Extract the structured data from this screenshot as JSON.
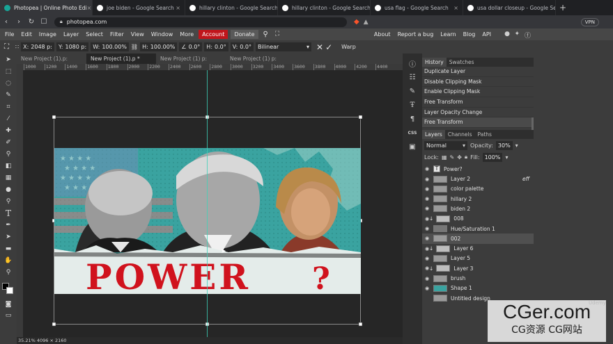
{
  "browser": {
    "tabs": [
      {
        "title": "Photopea | Online Photo Edi",
        "active": true,
        "favicon_color": "#18a497"
      },
      {
        "title": "joe biden - Google Search",
        "active": false,
        "favicon_color": "#ffffff"
      },
      {
        "title": "hillary clinton - Google Search",
        "active": false,
        "favicon_color": "#ffffff"
      },
      {
        "title": "hillary clinton - Google Search",
        "active": false,
        "favicon_color": "#ffffff"
      },
      {
        "title": "usa flag - Google Search",
        "active": false,
        "favicon_color": "#ffffff"
      },
      {
        "title": "usa dollar closeup - Google Sea",
        "active": false,
        "favicon_color": "#ffffff"
      }
    ],
    "url": "photopea.com",
    "vpn_label": "VPN"
  },
  "menu": {
    "items": [
      "File",
      "Edit",
      "Image",
      "Layer",
      "Select",
      "Filter",
      "View",
      "Window",
      "More"
    ],
    "account": "Account",
    "donate": "Donate",
    "right": [
      "About",
      "Report a bug",
      "Learn",
      "Blog",
      "API"
    ]
  },
  "options": {
    "x_label": "X:",
    "x_value": "2048 p:",
    "y_label": "Y:",
    "y_value": "1080 p:",
    "w_label": "W:",
    "w_value": "100.00%",
    "h_label": "H:",
    "h_value": "100.00%",
    "angle_value": "0.0°",
    "hskew_label": "H:",
    "hskew_value": "0.0°",
    "vskew_label": "V:",
    "vskew_value": "0.0°",
    "interp": "Bilinear",
    "warp": "Warp"
  },
  "doc_tabs": [
    {
      "title": "New Project (1).p:",
      "active": false
    },
    {
      "title": "New Project (1).p  *",
      "active": true
    },
    {
      "title": "New Project (1) p:",
      "active": false
    },
    {
      "title": "New Project (1) p:",
      "active": false
    }
  ],
  "ruler_ticks": [
    "1000",
    "1200",
    "1400",
    "1600",
    "1800",
    "2000",
    "2200",
    "2400",
    "2600",
    "2800",
    "3000",
    "3200",
    "3400",
    "3600",
    "3800",
    "4000",
    "4200",
    "4400"
  ],
  "artwork": {
    "headline": "POWER",
    "question": "?",
    "teal_color": "#3aa3a0",
    "red_color": "#d0121d"
  },
  "status": "35.21%   4096 × 2160",
  "history": {
    "tabs": [
      "History",
      "Swatches"
    ],
    "items": [
      "Duplicate Layer",
      "Disable Clipping Mask",
      "Enable Clipping Mask",
      "Free Transform",
      "Layer Opacity Change",
      "Free Transform"
    ]
  },
  "layers_panel": {
    "tabs": [
      "Layers",
      "Channels",
      "Paths"
    ],
    "blend_mode": "Normal",
    "opacity_label": "Opacity:",
    "opacity_value": "30%",
    "lock_label": "Lock:",
    "fill_label": "Fill:",
    "fill_value": "100%",
    "layers": [
      {
        "name": "Power?",
        "visible": true,
        "kind": "text",
        "selected": false
      },
      {
        "name": "Layer 2",
        "visible": true,
        "kind": "image",
        "selected": false,
        "fx": "eff"
      },
      {
        "name": "color palette",
        "visible": true,
        "kind": "image",
        "selected": false
      },
      {
        "name": "hillary 2",
        "visible": true,
        "kind": "image",
        "selected": false
      },
      {
        "name": "biden 2",
        "visible": true,
        "kind": "image",
        "selected": false
      },
      {
        "name": "008",
        "visible": true,
        "kind": "clip",
        "selected": false
      },
      {
        "name": "Hue/Saturation 1",
        "visible": true,
        "kind": "adjust",
        "selected": false
      },
      {
        "name": "002",
        "visible": true,
        "kind": "image",
        "selected": true
      },
      {
        "name": "Layer 6",
        "visible": true,
        "kind": "clip",
        "selected": false
      },
      {
        "name": "Layer 5",
        "visible": true,
        "kind": "image",
        "selected": false
      },
      {
        "name": "Layer 3",
        "visible": true,
        "kind": "clip",
        "selected": false
      },
      {
        "name": "brush",
        "visible": true,
        "kind": "image",
        "selected": false
      },
      {
        "name": "Shape 1",
        "visible": true,
        "kind": "shape",
        "selected": false
      },
      {
        "name": "Untitled design",
        "visible": false,
        "kind": "image",
        "selected": false
      }
    ]
  },
  "watermark": {
    "brand": "CGer.com",
    "sub": "CG资源 CG网站",
    "udemy": "Udemy"
  }
}
